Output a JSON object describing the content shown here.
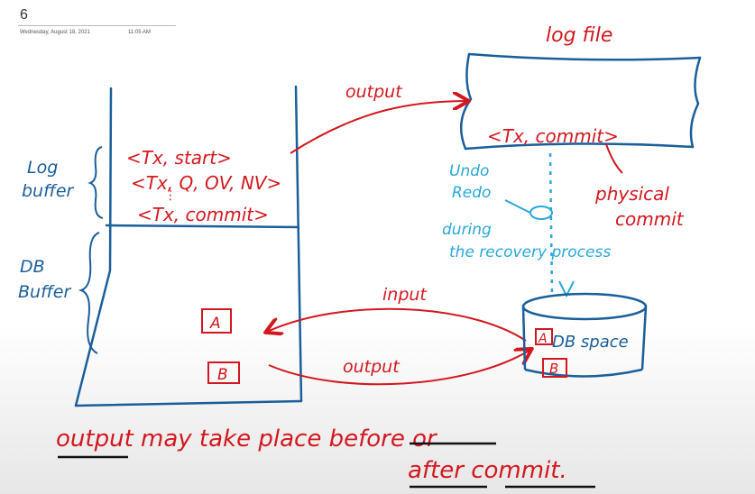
{
  "header": {
    "page_number": "6",
    "date": "Wednesday, August 18, 2021",
    "time": "11:05 AM"
  },
  "log_file": {
    "title": "log file",
    "entry": "<Tx, commit>"
  },
  "memory": {
    "log_buffer_label": "Log buffer",
    "db_buffer_label": "DB Buffer",
    "log_entries": [
      "<Tx, start>",
      "<Tx, Q, OV, NV>",
      "<Tx, commit>"
    ],
    "blocks": [
      "A",
      "B"
    ]
  },
  "arrows": {
    "output_top": "output",
    "input": "input",
    "output_bottom": "output"
  },
  "notes": {
    "undo": "Undo",
    "redo": "Redo",
    "recovery": "during the recovery process",
    "physical_commit": "physical commit"
  },
  "db_space": {
    "label": "DB space",
    "blocks": [
      "A",
      "B"
    ]
  },
  "footer": {
    "line1": "output may take place before or",
    "line2": "after commit."
  }
}
